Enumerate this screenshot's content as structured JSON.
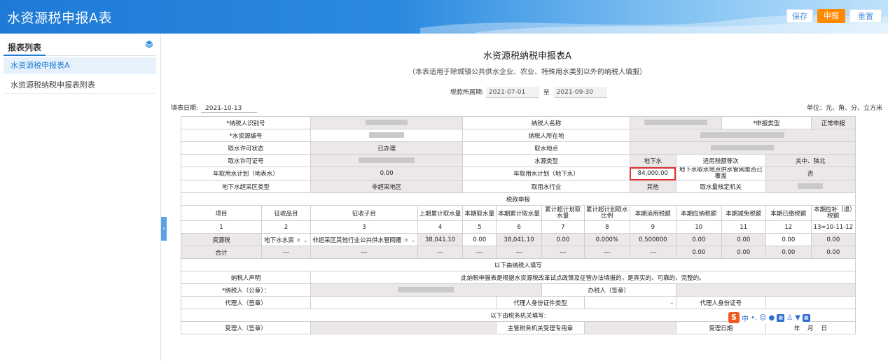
{
  "header": {
    "title": "水资源税申报A表",
    "save_label": "保存",
    "submit_label": "申报",
    "reset_label": "重置"
  },
  "sidebar": {
    "heading": "报表列表",
    "items": [
      {
        "label": "水资源税申报表A"
      },
      {
        "label": "水资源税纳税申报表附表"
      }
    ]
  },
  "doc": {
    "title": "水资源税纳税申报表A",
    "subtitle": "（本表适用于除城镇公共供水企业、农业、特殊用水类别以外的纳税人填报）",
    "period_label": "税款所属期:",
    "period_start": "2021-07-01",
    "period_sep": "至",
    "period_end": "2021-09-30",
    "fill_date_label": "填表日期:",
    "fill_date": "2021-10-13",
    "unit": "单位：元、角、分、立方米"
  },
  "info": {
    "taxpayer_id_label": "*纳税人识别号",
    "taxpayer_name_label": "纳税人名称",
    "declare_type_label": "*申报类型",
    "declare_type": "正常申报",
    "water_code_label": "*水资源编号",
    "location_label": "纳税人所在地",
    "permit_status_label": "取水许可状态",
    "permit_status": "已办理",
    "intake_site_label": "取水地点",
    "permit_no_label": "取水许可证号",
    "source_type_label": "水源类型",
    "source_type": "地下水",
    "tax_grade_label": "适用税额等次",
    "tax_grade": "关中、陕北",
    "surface_plan_label": "年取用水计划（地表水）",
    "surface_plan": "0.00",
    "ground_plan_label": "年取用水计划（地下水）",
    "ground_plan": "84,000.00",
    "covered_label": "地下水取水地点供水管网是否已覆盖",
    "covered": "否",
    "overdraft_label": "地下水超采区类型",
    "overdraft": "非超采地区",
    "industry_label": "取用水行业",
    "industry": "其他",
    "verify_label": "取水量核定机关"
  },
  "tax": {
    "section_label": "税款申报",
    "headers": [
      "项目",
      "征收品目",
      "征收子目",
      "上期累计取水量",
      "本期取水量",
      "本期累计取水量",
      "累计超计划取水量",
      "累计超计划取水比例",
      "本期适用税额",
      "本期应纳税额",
      "本期减免税额",
      "本期已缴税额",
      "本期应补（退）税额"
    ],
    "index": [
      "1",
      "2",
      "3",
      "4",
      "5",
      "6",
      "7",
      "8",
      "9",
      "10",
      "11",
      "12",
      "13=10-11-12"
    ],
    "row": [
      "资源税",
      "地下水水资",
      "非超采区其他行业公共供水管网覆",
      "38,041.10",
      "0.00",
      "38,041.10",
      "0.00",
      "0.000%",
      "0.500000",
      "0.00",
      "0.00",
      "0.00",
      "0.00"
    ],
    "total": [
      "合计",
      "---",
      "---",
      "---",
      "---",
      "---",
      "---",
      "---",
      "---",
      "0.00",
      "0.00",
      "0.00",
      "0.00"
    ]
  },
  "decl": {
    "section_label": "以下由纳税人填写",
    "statement_label": "纳税人声明",
    "statement": "此纳税申报表是根据水资源税改革试点政策及征管办法填报的，是真实的、可靠的、完整的。",
    "taxpayer_seal_label": "*纳税人（公章）：",
    "handler_label": "办税人（签章）",
    "agent_label": "代理人（签章）",
    "agent_id_type_label": "代理人身份证件类型",
    "agent_id_label": "代理人身份证号",
    "tax_section_label": "以下由税务机关填写:",
    "receiver_label": "受理人（签章）",
    "office_seal_label": "主管税务机关受理专用章",
    "accept_date_label": "受理日期",
    "year": "年",
    "month": "月",
    "day": "日"
  },
  "ime": {
    "lang": "中"
  }
}
